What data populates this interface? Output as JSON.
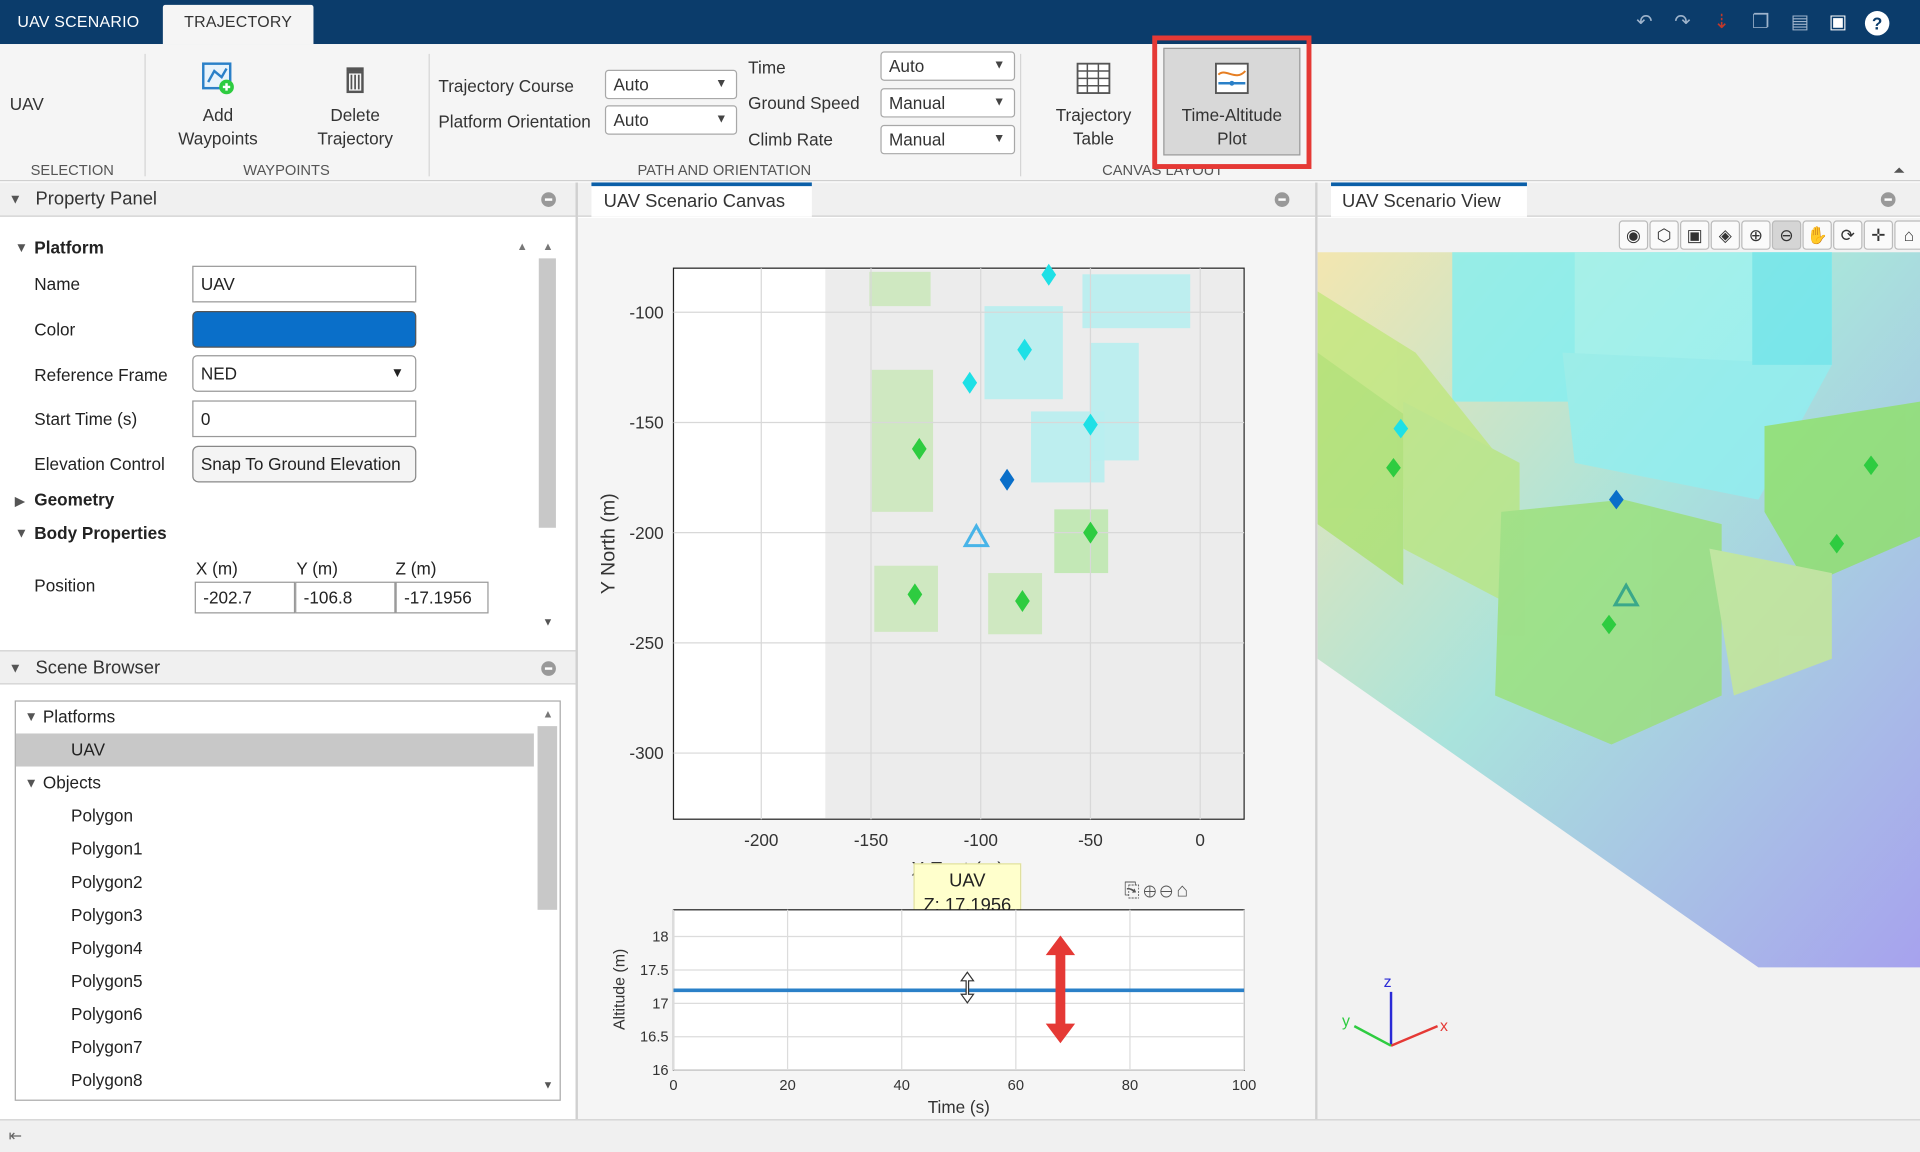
{
  "header": {
    "tabs": [
      {
        "label": "UAV SCENARIO"
      },
      {
        "label": "TRAJECTORY"
      }
    ],
    "quick_access": [
      "undo-icon",
      "redo-icon",
      "download-icon",
      "copy-icon",
      "paste-icon",
      "save-icon",
      "help-icon"
    ]
  },
  "ribbon": {
    "selection": {
      "value": "UAV",
      "section": "SELECTION"
    },
    "waypoints": {
      "add_l1": "Add",
      "add_l2": "Waypoints",
      "del_l1": "Delete",
      "del_l2": "Trajectory",
      "section": "WAYPOINTS"
    },
    "path": {
      "trajectory_course_label": "Trajectory Course",
      "trajectory_course_value": "Auto",
      "platform_orientation_label": "Platform Orientation",
      "platform_orientation_value": "Auto",
      "time_label": "Time",
      "time_value": "Auto",
      "ground_speed_label": "Ground Speed",
      "ground_speed_value": "Manual",
      "climb_rate_label": "Climb Rate",
      "climb_rate_value": "Manual",
      "section": "PATH AND ORIENTATION"
    },
    "canvas_layout": {
      "table_l1": "Trajectory",
      "table_l2": "Table",
      "plot_l1": "Time-Altitude",
      "plot_l2": "Plot",
      "section": "CANVAS LAYOUT"
    }
  },
  "property_panel": {
    "title": "Property Panel",
    "platform_header": "Platform",
    "name_label": "Name",
    "name_value": "UAV",
    "color_label": "Color",
    "color_value": "#0a6fc9",
    "ref_frame_label": "Reference Frame",
    "ref_frame_value": "NED",
    "start_time_label": "Start Time (s)",
    "start_time_value": "0",
    "elevation_label": "Elevation Control",
    "elevation_button": "Snap To Ground Elevation",
    "geometry_header": "Geometry",
    "body_header": "Body Properties",
    "position_label": "Position",
    "x_label": "X (m)",
    "y_label": "Y (m)",
    "z_label": "Z (m)",
    "x_value": "-202.7",
    "y_value": "-106.8",
    "z_value": "-17.1956"
  },
  "scene_browser": {
    "title": "Scene Browser",
    "platforms_label": "Platforms",
    "platforms": [
      "UAV"
    ],
    "objects_label": "Objects",
    "objects": [
      "Polygon",
      "Polygon1",
      "Polygon2",
      "Polygon3",
      "Polygon4",
      "Polygon5",
      "Polygon6",
      "Polygon7",
      "Polygon8"
    ]
  },
  "canvas": {
    "title": "UAV Scenario Canvas",
    "ylabel": "Y North (m)",
    "xlabel": "X East (m)",
    "tooltip_title": "UAV",
    "tooltip_value": "Z: 17.1956"
  },
  "view": {
    "title": "UAV Scenario View",
    "axis_x": "x",
    "axis_y": "y",
    "axis_z": "z",
    "toolbar": [
      "hide-icon",
      "cube-icon",
      "cube-front-icon",
      "cube-side-icon",
      "zoom-in-icon",
      "zoom-out-icon",
      "pan-icon",
      "rotate-icon",
      "crosshair-icon",
      "home-icon"
    ]
  },
  "chart_data": [
    {
      "type": "scatter",
      "xlabel": "X East (m)",
      "ylabel": "Y North (m)",
      "xlim": [
        -240,
        20
      ],
      "ylim": [
        -330,
        -80
      ],
      "xticks": [
        -200,
        -150,
        -100,
        -50,
        0
      ],
      "yticks": [
        -100,
        -150,
        -200,
        -250,
        -300
      ],
      "series": [
        {
          "name": "UAV",
          "points": [
            [
              -102,
              -202
            ]
          ],
          "marker": "triangle"
        },
        {
          "name": "",
          "points": [
            [
              -69,
              -83
            ],
            [
              -105,
              -132
            ],
            [
              -80,
              -117
            ],
            [
              -50,
              -151
            ]
          ],
          "color": "#1ee0e6",
          "marker": "diamond"
        },
        {
          "name": "",
          "points": [
            [
              -88,
              -176
            ]
          ],
          "color": "#0a6fc9",
          "marker": "diamond"
        },
        {
          "name": "",
          "points": [
            [
              -128,
              -162
            ],
            [
              -50,
              -200
            ],
            [
              -130,
              -228
            ],
            [
              -81,
              -231
            ]
          ],
          "color": "#2ecc40",
          "marker": "diamond"
        }
      ]
    },
    {
      "type": "line",
      "xlabel": "Time (s)",
      "ylabel": "Altitude (m)",
      "xlim": [
        0,
        100
      ],
      "ylim": [
        16,
        18.4
      ],
      "xticks": [
        0,
        20,
        40,
        60,
        80,
        100
      ],
      "yticks": [
        16,
        16.5,
        17,
        17.5,
        18
      ],
      "series": [
        {
          "name": "UAV",
          "x": [
            0,
            100
          ],
          "y": [
            17.1956,
            17.1956
          ],
          "color": "#2a80c8"
        }
      ]
    }
  ]
}
